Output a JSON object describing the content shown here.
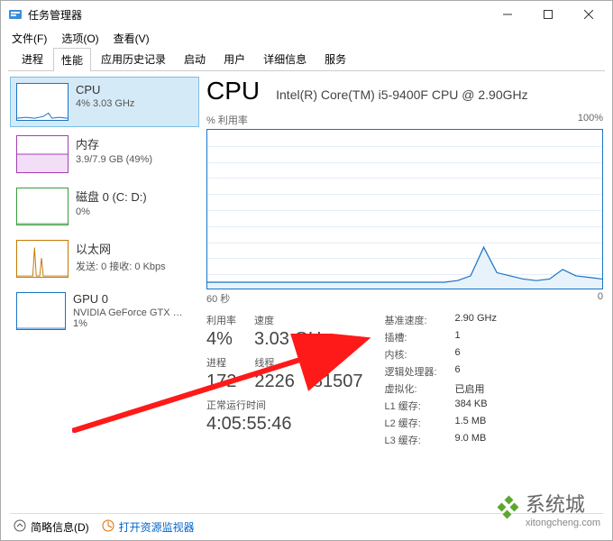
{
  "window": {
    "title": "任务管理器"
  },
  "menu": {
    "file": "文件(F)",
    "options": "选项(O)",
    "view": "查看(V)"
  },
  "tabs": {
    "processes": "进程",
    "performance": "性能",
    "app_history": "应用历史记录",
    "startup": "启动",
    "users": "用户",
    "details": "详细信息",
    "services": "服务"
  },
  "sidebar": {
    "items": [
      {
        "name": "CPU",
        "sub": "4% 3.03 GHz",
        "color": "#1a73c7"
      },
      {
        "name": "内存",
        "sub": "3.9/7.9 GB (49%)",
        "color": "#a43fb5"
      },
      {
        "name": "磁盘 0 (C: D:)",
        "sub": "0%",
        "color": "#3a9c3a"
      },
      {
        "name": "以太网",
        "sub": "发送: 0 接收: 0 Kbps",
        "color": "#c27a00"
      },
      {
        "name": "GPU 0",
        "sub": "NVIDIA GeForce GTX … 1%",
        "color": "#1a73c7"
      }
    ]
  },
  "main": {
    "cpu_title": "CPU",
    "cpu_model": "Intel(R) Core(TM) i5-9400F CPU @ 2.90GHz",
    "util_label": "% 利用率",
    "util_max": "100%",
    "x_left": "60 秒",
    "x_right": "0",
    "stats": {
      "util_label": "利用率",
      "util_value": "4%",
      "speed_label": "速度",
      "speed_value": "3.03 GHz",
      "proc_label": "进程",
      "proc_value": "172",
      "threads_label": "线程",
      "threads_value": "2226",
      "handles_label": "句柄",
      "handles_value": "81507",
      "uptime_label": "正常运行时间",
      "uptime_value": "4:05:55:46"
    },
    "kv": {
      "base_speed_k": "基准速度:",
      "base_speed_v": "2.90 GHz",
      "sockets_k": "插槽:",
      "sockets_v": "1",
      "cores_k": "内核:",
      "cores_v": "6",
      "lproc_k": "逻辑处理器:",
      "lproc_v": "6",
      "virt_k": "虚拟化:",
      "virt_v": "已启用",
      "l1_k": "L1 缓存:",
      "l1_v": "384 KB",
      "l2_k": "L2 缓存:",
      "l2_v": "1.5 MB",
      "l3_k": "L3 缓存:",
      "l3_v": "9.0 MB"
    }
  },
  "footer": {
    "less": "简略信息(D)",
    "resmon": "打开资源监视器"
  },
  "watermark": {
    "cn": "系统城",
    "en": "xitongcheng.com"
  },
  "chart_data": {
    "type": "line",
    "title": "% 利用率",
    "xlabel": "60 秒 → 0",
    "ylabel": "% 利用率",
    "ylim": [
      0,
      100
    ],
    "x_seconds": [
      60,
      58,
      56,
      54,
      52,
      50,
      48,
      46,
      44,
      42,
      40,
      38,
      36,
      34,
      32,
      30,
      28,
      26,
      24,
      22,
      20,
      18,
      16,
      14,
      12,
      10,
      8,
      6,
      4,
      2,
      0
    ],
    "values_percent": [
      4,
      4,
      4,
      4,
      4,
      4,
      4,
      4,
      4,
      4,
      4,
      4,
      4,
      4,
      4,
      4,
      4,
      4,
      4,
      5,
      8,
      26,
      10,
      8,
      6,
      5,
      6,
      12,
      8,
      7,
      6
    ],
    "sidebar_mini": {
      "cpu_percent": 4,
      "memory_percent": 49,
      "disk_percent": 0,
      "ethernet_kbps": 0,
      "gpu_percent": 1
    }
  }
}
